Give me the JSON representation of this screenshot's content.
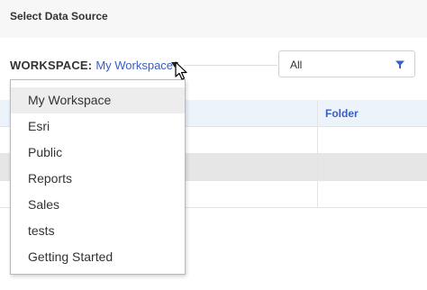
{
  "header": {
    "title": "Select Data Source"
  },
  "workspace": {
    "label": "WORKSPACE:",
    "value": "My Workspace",
    "options": [
      "My Workspace",
      "Esri",
      "Public",
      "Reports",
      "Sales",
      "tests",
      "Getting Started"
    ],
    "selected_index": 0
  },
  "filter": {
    "value": "All",
    "icon": "filter-icon"
  },
  "table": {
    "columns": [
      "Folder"
    ]
  },
  "colors": {
    "accent": "#3a5ec4",
    "header_row": "#ecf3fb",
    "selected_row": "#e6e6e6"
  }
}
